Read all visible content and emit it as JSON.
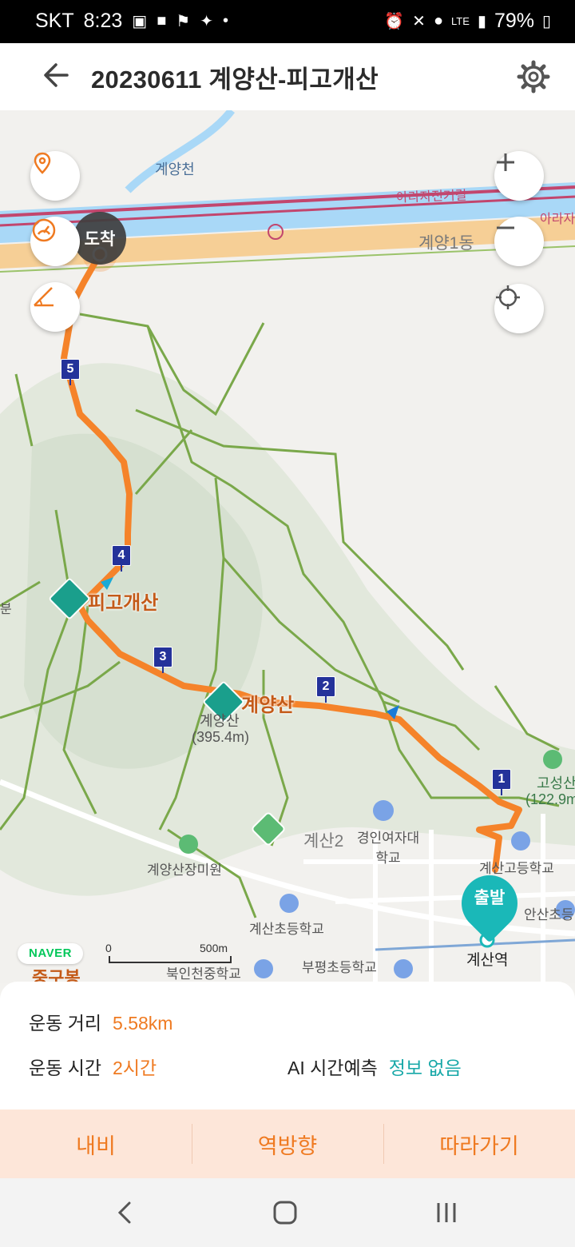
{
  "status": {
    "carrier": "SKT",
    "time": "8:23",
    "network": "LTE",
    "battery": "79%"
  },
  "header": {
    "title": "20230611 계양산-피고개산",
    "back_icon": "back-arrow-icon",
    "settings_icon": "gear-icon"
  },
  "map": {
    "labels": {
      "stream": "계양천",
      "bike_road": "아라자전거길",
      "bike_road_2": "아라자",
      "district1": "계양1동",
      "district2": "계산2",
      "univ": "경인여자대학교",
      "gosung": "고성산",
      "gosung_elev": "(122.9m",
      "garden": "계양산장미원",
      "gyesan_elem": "계산초등학교",
      "gyesan_high": "계산고등학교",
      "ansan_elem": "안산초등",
      "bupyeong_elem": "부평초등학교",
      "bukin_mid": "북인천중학교",
      "gyesan_station": "계산역",
      "left_partial": "분",
      "bottom_partial": "중구봉",
      "gyeyangsan_sub": "계양산",
      "gyeyangsan_elev": "(395.4m)"
    },
    "peaks": {
      "pigogaesan": "피고개산",
      "gyeyangsan": "계양산"
    },
    "markers": [
      "1",
      "2",
      "3",
      "4",
      "5"
    ],
    "arrive_label": "도착",
    "depart_label": "출발",
    "naver": "NAVER",
    "scale_zero": "0",
    "scale_dist": "500m",
    "controls": [
      "location-pin-icon",
      "speedometer-icon",
      "slope-icon",
      "zoom-in-icon",
      "zoom-out-icon",
      "crosshair-icon"
    ],
    "colors": {
      "route": "#f5832a",
      "trail": "#7aa84a",
      "peak": "#1a9f8c",
      "marker": "#24329a"
    }
  },
  "stats": {
    "distance_label": "운동 거리",
    "distance_value": "5.58km",
    "time_label": "운동 시간",
    "time_value": "2시간",
    "ai_label": "AI 시간예측",
    "ai_value": "정보 없음"
  },
  "actions": {
    "nav": "내비",
    "reverse": "역방향",
    "follow": "따라가기"
  }
}
